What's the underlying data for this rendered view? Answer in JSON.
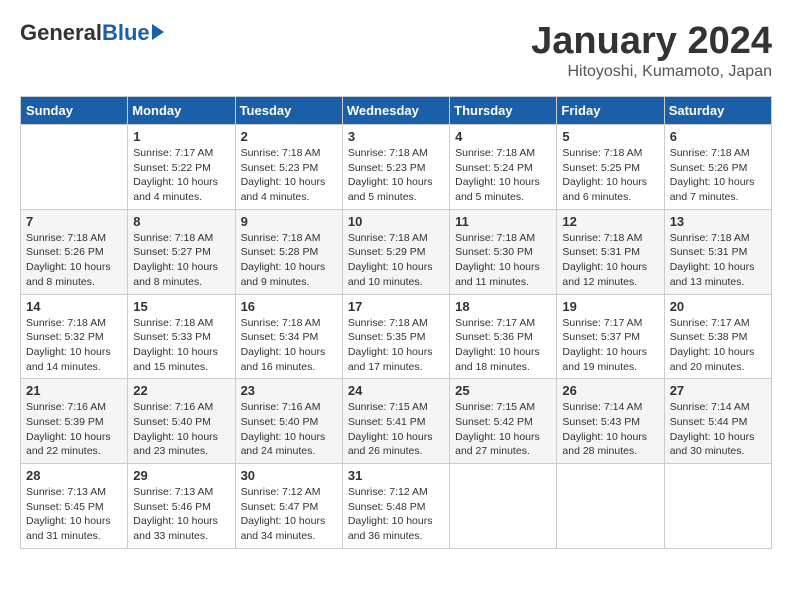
{
  "header": {
    "logo": {
      "general": "General",
      "blue": "Blue"
    },
    "title": "January 2024",
    "location": "Hitoyoshi, Kumamoto, Japan"
  },
  "weekdays": [
    "Sunday",
    "Monday",
    "Tuesday",
    "Wednesday",
    "Thursday",
    "Friday",
    "Saturday"
  ],
  "weeks": [
    [
      {
        "day": "",
        "sunrise": "",
        "sunset": "",
        "daylight": ""
      },
      {
        "day": "1",
        "sunrise": "Sunrise: 7:17 AM",
        "sunset": "Sunset: 5:22 PM",
        "daylight": "Daylight: 10 hours and 4 minutes."
      },
      {
        "day": "2",
        "sunrise": "Sunrise: 7:18 AM",
        "sunset": "Sunset: 5:23 PM",
        "daylight": "Daylight: 10 hours and 4 minutes."
      },
      {
        "day": "3",
        "sunrise": "Sunrise: 7:18 AM",
        "sunset": "Sunset: 5:23 PM",
        "daylight": "Daylight: 10 hours and 5 minutes."
      },
      {
        "day": "4",
        "sunrise": "Sunrise: 7:18 AM",
        "sunset": "Sunset: 5:24 PM",
        "daylight": "Daylight: 10 hours and 5 minutes."
      },
      {
        "day": "5",
        "sunrise": "Sunrise: 7:18 AM",
        "sunset": "Sunset: 5:25 PM",
        "daylight": "Daylight: 10 hours and 6 minutes."
      },
      {
        "day": "6",
        "sunrise": "Sunrise: 7:18 AM",
        "sunset": "Sunset: 5:26 PM",
        "daylight": "Daylight: 10 hours and 7 minutes."
      }
    ],
    [
      {
        "day": "7",
        "sunrise": "Sunrise: 7:18 AM",
        "sunset": "Sunset: 5:26 PM",
        "daylight": "Daylight: 10 hours and 8 minutes."
      },
      {
        "day": "8",
        "sunrise": "Sunrise: 7:18 AM",
        "sunset": "Sunset: 5:27 PM",
        "daylight": "Daylight: 10 hours and 8 minutes."
      },
      {
        "day": "9",
        "sunrise": "Sunrise: 7:18 AM",
        "sunset": "Sunset: 5:28 PM",
        "daylight": "Daylight: 10 hours and 9 minutes."
      },
      {
        "day": "10",
        "sunrise": "Sunrise: 7:18 AM",
        "sunset": "Sunset: 5:29 PM",
        "daylight": "Daylight: 10 hours and 10 minutes."
      },
      {
        "day": "11",
        "sunrise": "Sunrise: 7:18 AM",
        "sunset": "Sunset: 5:30 PM",
        "daylight": "Daylight: 10 hours and 11 minutes."
      },
      {
        "day": "12",
        "sunrise": "Sunrise: 7:18 AM",
        "sunset": "Sunset: 5:31 PM",
        "daylight": "Daylight: 10 hours and 12 minutes."
      },
      {
        "day": "13",
        "sunrise": "Sunrise: 7:18 AM",
        "sunset": "Sunset: 5:31 PM",
        "daylight": "Daylight: 10 hours and 13 minutes."
      }
    ],
    [
      {
        "day": "14",
        "sunrise": "Sunrise: 7:18 AM",
        "sunset": "Sunset: 5:32 PM",
        "daylight": "Daylight: 10 hours and 14 minutes."
      },
      {
        "day": "15",
        "sunrise": "Sunrise: 7:18 AM",
        "sunset": "Sunset: 5:33 PM",
        "daylight": "Daylight: 10 hours and 15 minutes."
      },
      {
        "day": "16",
        "sunrise": "Sunrise: 7:18 AM",
        "sunset": "Sunset: 5:34 PM",
        "daylight": "Daylight: 10 hours and 16 minutes."
      },
      {
        "day": "17",
        "sunrise": "Sunrise: 7:18 AM",
        "sunset": "Sunset: 5:35 PM",
        "daylight": "Daylight: 10 hours and 17 minutes."
      },
      {
        "day": "18",
        "sunrise": "Sunrise: 7:17 AM",
        "sunset": "Sunset: 5:36 PM",
        "daylight": "Daylight: 10 hours and 18 minutes."
      },
      {
        "day": "19",
        "sunrise": "Sunrise: 7:17 AM",
        "sunset": "Sunset: 5:37 PM",
        "daylight": "Daylight: 10 hours and 19 minutes."
      },
      {
        "day": "20",
        "sunrise": "Sunrise: 7:17 AM",
        "sunset": "Sunset: 5:38 PM",
        "daylight": "Daylight: 10 hours and 20 minutes."
      }
    ],
    [
      {
        "day": "21",
        "sunrise": "Sunrise: 7:16 AM",
        "sunset": "Sunset: 5:39 PM",
        "daylight": "Daylight: 10 hours and 22 minutes."
      },
      {
        "day": "22",
        "sunrise": "Sunrise: 7:16 AM",
        "sunset": "Sunset: 5:40 PM",
        "daylight": "Daylight: 10 hours and 23 minutes."
      },
      {
        "day": "23",
        "sunrise": "Sunrise: 7:16 AM",
        "sunset": "Sunset: 5:40 PM",
        "daylight": "Daylight: 10 hours and 24 minutes."
      },
      {
        "day": "24",
        "sunrise": "Sunrise: 7:15 AM",
        "sunset": "Sunset: 5:41 PM",
        "daylight": "Daylight: 10 hours and 26 minutes."
      },
      {
        "day": "25",
        "sunrise": "Sunrise: 7:15 AM",
        "sunset": "Sunset: 5:42 PM",
        "daylight": "Daylight: 10 hours and 27 minutes."
      },
      {
        "day": "26",
        "sunrise": "Sunrise: 7:14 AM",
        "sunset": "Sunset: 5:43 PM",
        "daylight": "Daylight: 10 hours and 28 minutes."
      },
      {
        "day": "27",
        "sunrise": "Sunrise: 7:14 AM",
        "sunset": "Sunset: 5:44 PM",
        "daylight": "Daylight: 10 hours and 30 minutes."
      }
    ],
    [
      {
        "day": "28",
        "sunrise": "Sunrise: 7:13 AM",
        "sunset": "Sunset: 5:45 PM",
        "daylight": "Daylight: 10 hours and 31 minutes."
      },
      {
        "day": "29",
        "sunrise": "Sunrise: 7:13 AM",
        "sunset": "Sunset: 5:46 PM",
        "daylight": "Daylight: 10 hours and 33 minutes."
      },
      {
        "day": "30",
        "sunrise": "Sunrise: 7:12 AM",
        "sunset": "Sunset: 5:47 PM",
        "daylight": "Daylight: 10 hours and 34 minutes."
      },
      {
        "day": "31",
        "sunrise": "Sunrise: 7:12 AM",
        "sunset": "Sunset: 5:48 PM",
        "daylight": "Daylight: 10 hours and 36 minutes."
      },
      {
        "day": "",
        "sunrise": "",
        "sunset": "",
        "daylight": ""
      },
      {
        "day": "",
        "sunrise": "",
        "sunset": "",
        "daylight": ""
      },
      {
        "day": "",
        "sunrise": "",
        "sunset": "",
        "daylight": ""
      }
    ]
  ]
}
